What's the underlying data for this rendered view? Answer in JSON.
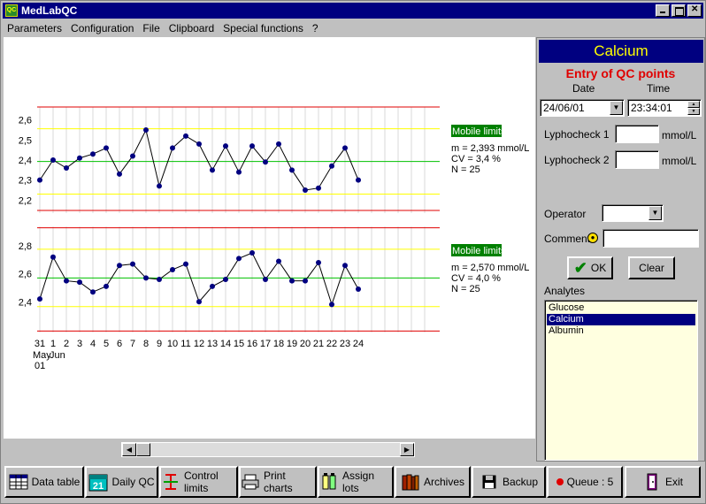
{
  "app": {
    "title": "MedLabQC",
    "icon": "app-icon"
  },
  "menu": [
    "Parameters",
    "Configuration",
    "File",
    "Clipboard",
    "Special functions",
    "?"
  ],
  "panel": {
    "analyte": "Calcium",
    "entry_title": "Entry of QC points",
    "date_label": "Date",
    "time_label": "Time",
    "date_value": "24/06/01",
    "time_value": "23:34:01",
    "lypho1_label": "Lyphocheck 1",
    "lypho2_label": "Lyphocheck 2",
    "unit1": "mmol/L",
    "unit2": "mmol/L",
    "operator_label": "Operator",
    "comment_label": "Comment",
    "ok_label": "OK",
    "clear_label": "Clear",
    "analytes_label": "Analytes",
    "analytes": [
      "Glucose",
      "Calcium",
      "Albumin"
    ],
    "selected_analyte": 1
  },
  "toolbar": {
    "data_table": "Data table",
    "daily_qc": "Daily QC",
    "daily_qc_icon_day": "21",
    "control_limits": "Control limits",
    "print_charts": "Print charts",
    "assign_lots": "Assign lots",
    "archives": "Archives",
    "backup": "Backup",
    "queue": "Queue : 5",
    "exit": "Exit"
  },
  "chart_data": [
    {
      "type": "line",
      "legend_title": "Mobile limits",
      "stats": [
        "m = 2,393 mmol/L",
        "CV = 3,4 %",
        "N = 25"
      ],
      "ylim": [
        2.135,
        2.665
      ],
      "yticks": [
        "2,2",
        "2,3",
        "2,4",
        "2,5",
        "2,6"
      ],
      "ytick_values": [
        2.2,
        2.3,
        2.4,
        2.5,
        2.6
      ],
      "limit_lines": {
        "mean": 2.393,
        "warn": [
          2.23,
          2.556
        ],
        "action": [
          2.148,
          2.665
        ]
      },
      "values": [
        2.3,
        2.4,
        2.36,
        2.41,
        2.43,
        2.46,
        2.33,
        2.42,
        2.55,
        2.27,
        2.46,
        2.52,
        2.48,
        2.35,
        2.47,
        2.34,
        2.47,
        2.39,
        2.48,
        2.35,
        2.25,
        2.26,
        2.37,
        2.46,
        2.3
      ]
    },
    {
      "type": "line",
      "legend_title": "Mobile limits",
      "stats": [
        "m = 2,570 mmol/L",
        "CV = 4,0 %",
        "N = 25"
      ],
      "ylim": [
        2.18,
        2.94
      ],
      "yticks": [
        "2,4",
        "2,6",
        "2,8"
      ],
      "ytick_values": [
        2.4,
        2.6,
        2.8
      ],
      "limit_lines": {
        "mean": 2.57,
        "warn": [
          2.365,
          2.776
        ],
        "action": [
          2.19,
          2.93
        ]
      },
      "values": [
        2.42,
        2.72,
        2.55,
        2.54,
        2.47,
        2.51,
        2.66,
        2.67,
        2.57,
        2.56,
        2.63,
        2.67,
        2.4,
        2.51,
        2.56,
        2.71,
        2.75,
        2.56,
        2.69,
        2.55,
        2.55,
        2.68,
        2.38,
        2.66,
        2.49
      ]
    }
  ],
  "x_axis": {
    "labels": [
      "31",
      "1",
      "2",
      "3",
      "4",
      "5",
      "6",
      "7",
      "8",
      "9",
      "10",
      "11",
      "12",
      "13",
      "14",
      "15",
      "16",
      "17",
      "18",
      "19",
      "20",
      "21",
      "22",
      "23",
      "24"
    ],
    "months": [
      "May",
      "Jun"
    ],
    "year": "01"
  },
  "colors": {
    "mean_line": "#00c000",
    "warn_line": "#ffff00",
    "action_line": "#e00000",
    "points": "#000080",
    "legend_bg": "#008000"
  }
}
